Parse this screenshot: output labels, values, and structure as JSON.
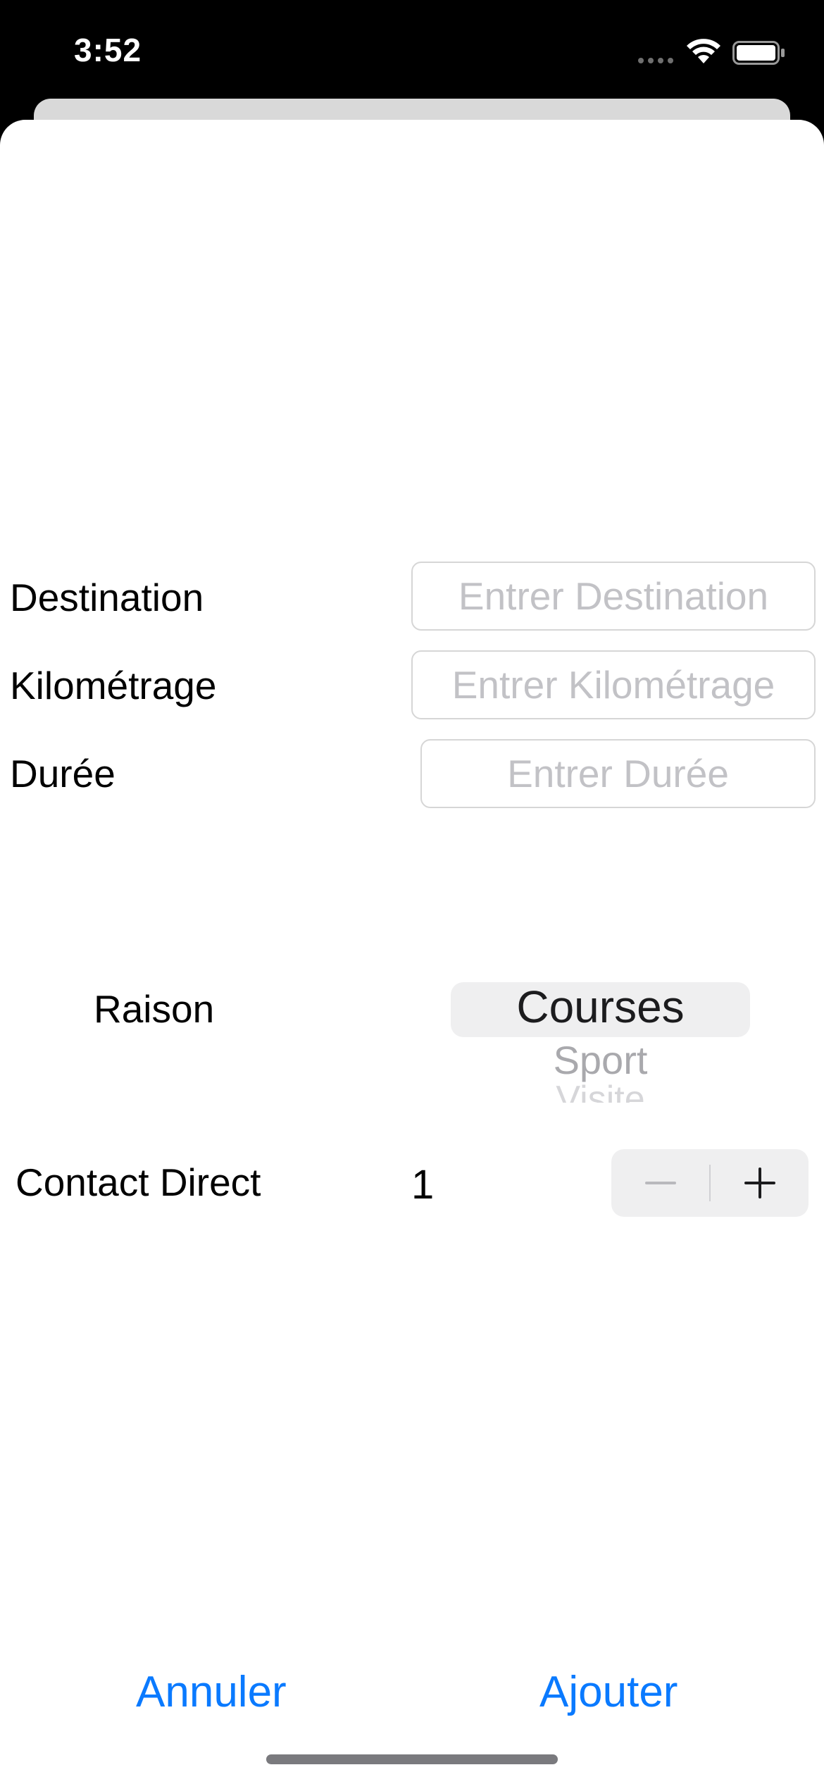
{
  "status_bar": {
    "time": "3:52",
    "signal_icon": "signal-dots-icon",
    "wifi_icon": "wifi-icon",
    "battery_icon": "battery-icon"
  },
  "form": {
    "destination": {
      "label": "Destination",
      "placeholder": "Entrer Destination",
      "value": ""
    },
    "kilometrage": {
      "label": "Kilométrage",
      "placeholder": "Entrer Kilométrage",
      "value": ""
    },
    "duree": {
      "label": "Durée",
      "placeholder": "Entrer Durée",
      "value": ""
    },
    "raison": {
      "label": "Raison",
      "options": [
        "Courses",
        "Sport",
        "Visite"
      ],
      "selected": "Courses"
    },
    "contact": {
      "label": "Contact Direct",
      "value": "1",
      "minus_icon": "minus-icon",
      "plus_icon": "plus-icon"
    }
  },
  "actions": {
    "cancel_label": "Annuler",
    "add_label": "Ajouter"
  },
  "colors": {
    "accent": "#0a7aff",
    "placeholder": "#c2c2c6",
    "background": "#ffffff"
  }
}
